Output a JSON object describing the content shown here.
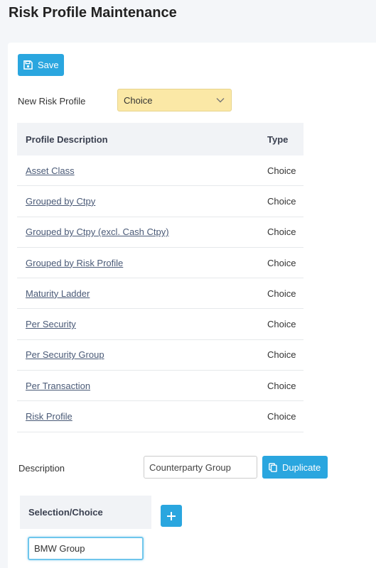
{
  "page": {
    "title": "Risk Profile Maintenance"
  },
  "toolbar": {
    "save_label": "Save"
  },
  "new_profile": {
    "label": "New Risk Profile",
    "selected": "Choice"
  },
  "table": {
    "headers": {
      "description": "Profile Description",
      "type": "Type"
    },
    "rows": [
      {
        "description": "Asset Class",
        "type": "Choice"
      },
      {
        "description": "Grouped by Ctpy",
        "type": "Choice"
      },
      {
        "description": "Grouped by Ctpy (excl. Cash Ctpy)",
        "type": "Choice"
      },
      {
        "description": "Grouped by Risk Profile",
        "type": "Choice"
      },
      {
        "description": "Maturity Ladder",
        "type": "Choice"
      },
      {
        "description": "Per Security",
        "type": "Choice"
      },
      {
        "description": "Per Security Group",
        "type": "Choice"
      },
      {
        "description": "Per Transaction",
        "type": "Choice"
      },
      {
        "description": "Risk Profile",
        "type": "Choice"
      }
    ]
  },
  "description_field": {
    "label": "Description",
    "value": "Counterparty Group"
  },
  "duplicate": {
    "label": "Duplicate"
  },
  "selection": {
    "header": "Selection/Choice",
    "value": "BMW Group"
  },
  "colors": {
    "accent": "#2aa6df",
    "select_bg": "#fbe8a6",
    "header_bg": "#f1f3f6",
    "link": "#4a5a77"
  }
}
